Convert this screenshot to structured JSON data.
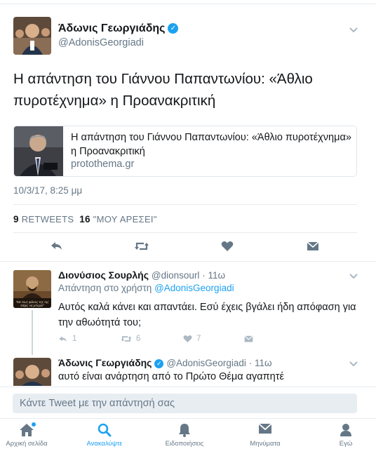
{
  "main_tweet": {
    "author_name": "Άδωνις Γεωργιάδης",
    "author_handle": "@AdonisGeorgiadi",
    "text": "Η απάντηση του Γιάννου Παπαντωνίου: «Άθλιο πυροτέχνημα» η Προανακριτική",
    "card": {
      "title": "Η απάντηση του Γιάννου Παπαντωνίου: «Άθλιο πυροτέχνημα» η Προανακριτική",
      "domain": "protothema.gr"
    },
    "timestamp": "10/3/17, 8:25 μμ",
    "retweets_count": "9",
    "retweets_label": "RETWEETS",
    "likes_count": "16",
    "likes_label": "\"ΜΟΥ ΑΡΕΣΕΙ\""
  },
  "reply1": {
    "author_name": "Διονύσιος Σουρλής",
    "author_handle": "@dionsourl",
    "time": "· 11ω",
    "replying_prefix": "Απάντηση στο χρήστη",
    "replying_to": "@AdonisGeorgiadi",
    "text": "Αυτός καλά κάνει και απαντάει. Εσύ έχεις βγάλει ήδη απόφαση για την αθωότητά του;",
    "reply_count": "1",
    "retweet_count": "6",
    "like_count": "7",
    "avatar_caption": "\"Με τους φίλους της της Θέμις να μπορεί\""
  },
  "reply2": {
    "author_name": "Άδωνις Γεωργιάδης",
    "author_handle": "@AdonisGeorgiadi",
    "time": "· 11ω",
    "text": "αυτό είναι ανάρτηση από το Πρώτο Θέμα αγαπητέ"
  },
  "composer": {
    "placeholder": "Κάντε Tweet με την απάντησή σας"
  },
  "tabs": [
    {
      "label": "Αρχική σελίδα",
      "icon": "home-icon"
    },
    {
      "label": "Ανακαλύψτε",
      "icon": "search-icon"
    },
    {
      "label": "Ειδοποιήσεις",
      "icon": "bell-icon"
    },
    {
      "label": "Μηνύματα",
      "icon": "envelope-icon"
    },
    {
      "label": "Εγώ",
      "icon": "person-icon"
    }
  ],
  "colors": {
    "accent": "#1da1f2",
    "text": "#14171a",
    "muted": "#657786",
    "icon": "#657786",
    "faint": "#aab8c2"
  }
}
